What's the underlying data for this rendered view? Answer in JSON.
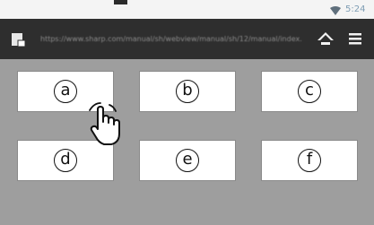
{
  "status_bar": {
    "time": "5:24",
    "wifi_icon": "wifi-icon",
    "accent_color": "#7e9db4"
  },
  "url_bar": {
    "page_icon": "page-icon",
    "url": "https://www.sharp.com/manual/sh/webview/manual/sh/12/manual/index.html",
    "home_icon": "home-icon",
    "menu_icon": "menu-icon"
  },
  "buttons": [
    {
      "label": "a"
    },
    {
      "label": "b"
    },
    {
      "label": "c"
    },
    {
      "label": "d"
    },
    {
      "label": "e"
    },
    {
      "label": "f"
    }
  ],
  "pointer": {
    "icon": "tap-hand-icon"
  }
}
